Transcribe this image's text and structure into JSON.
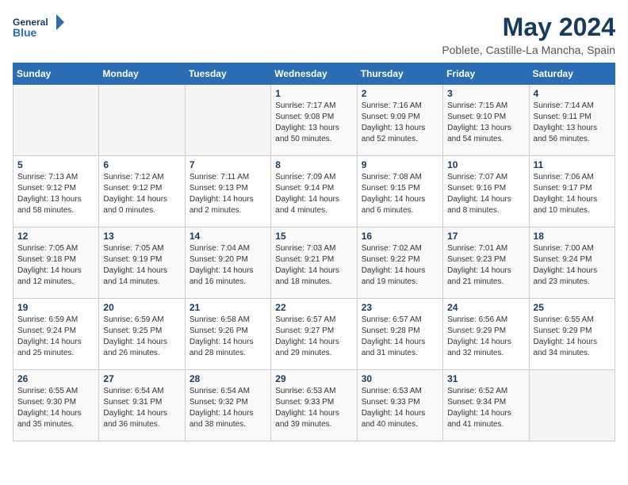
{
  "logo": {
    "line1": "General",
    "line2": "Blue"
  },
  "title": "May 2024",
  "location": "Poblete, Castille-La Mancha, Spain",
  "weekdays": [
    "Sunday",
    "Monday",
    "Tuesday",
    "Wednesday",
    "Thursday",
    "Friday",
    "Saturday"
  ],
  "weeks": [
    [
      {
        "day": "",
        "info": ""
      },
      {
        "day": "",
        "info": ""
      },
      {
        "day": "",
        "info": ""
      },
      {
        "day": "1",
        "info": "Sunrise: 7:17 AM\nSunset: 9:08 PM\nDaylight: 13 hours\nand 50 minutes."
      },
      {
        "day": "2",
        "info": "Sunrise: 7:16 AM\nSunset: 9:09 PM\nDaylight: 13 hours\nand 52 minutes."
      },
      {
        "day": "3",
        "info": "Sunrise: 7:15 AM\nSunset: 9:10 PM\nDaylight: 13 hours\nand 54 minutes."
      },
      {
        "day": "4",
        "info": "Sunrise: 7:14 AM\nSunset: 9:11 PM\nDaylight: 13 hours\nand 56 minutes."
      }
    ],
    [
      {
        "day": "5",
        "info": "Sunrise: 7:13 AM\nSunset: 9:12 PM\nDaylight: 13 hours\nand 58 minutes."
      },
      {
        "day": "6",
        "info": "Sunrise: 7:12 AM\nSunset: 9:12 PM\nDaylight: 14 hours\nand 0 minutes."
      },
      {
        "day": "7",
        "info": "Sunrise: 7:11 AM\nSunset: 9:13 PM\nDaylight: 14 hours\nand 2 minutes."
      },
      {
        "day": "8",
        "info": "Sunrise: 7:09 AM\nSunset: 9:14 PM\nDaylight: 14 hours\nand 4 minutes."
      },
      {
        "day": "9",
        "info": "Sunrise: 7:08 AM\nSunset: 9:15 PM\nDaylight: 14 hours\nand 6 minutes."
      },
      {
        "day": "10",
        "info": "Sunrise: 7:07 AM\nSunset: 9:16 PM\nDaylight: 14 hours\nand 8 minutes."
      },
      {
        "day": "11",
        "info": "Sunrise: 7:06 AM\nSunset: 9:17 PM\nDaylight: 14 hours\nand 10 minutes."
      }
    ],
    [
      {
        "day": "12",
        "info": "Sunrise: 7:05 AM\nSunset: 9:18 PM\nDaylight: 14 hours\nand 12 minutes."
      },
      {
        "day": "13",
        "info": "Sunrise: 7:05 AM\nSunset: 9:19 PM\nDaylight: 14 hours\nand 14 minutes."
      },
      {
        "day": "14",
        "info": "Sunrise: 7:04 AM\nSunset: 9:20 PM\nDaylight: 14 hours\nand 16 minutes."
      },
      {
        "day": "15",
        "info": "Sunrise: 7:03 AM\nSunset: 9:21 PM\nDaylight: 14 hours\nand 18 minutes."
      },
      {
        "day": "16",
        "info": "Sunrise: 7:02 AM\nSunset: 9:22 PM\nDaylight: 14 hours\nand 19 minutes."
      },
      {
        "day": "17",
        "info": "Sunrise: 7:01 AM\nSunset: 9:23 PM\nDaylight: 14 hours\nand 21 minutes."
      },
      {
        "day": "18",
        "info": "Sunrise: 7:00 AM\nSunset: 9:24 PM\nDaylight: 14 hours\nand 23 minutes."
      }
    ],
    [
      {
        "day": "19",
        "info": "Sunrise: 6:59 AM\nSunset: 9:24 PM\nDaylight: 14 hours\nand 25 minutes."
      },
      {
        "day": "20",
        "info": "Sunrise: 6:59 AM\nSunset: 9:25 PM\nDaylight: 14 hours\nand 26 minutes."
      },
      {
        "day": "21",
        "info": "Sunrise: 6:58 AM\nSunset: 9:26 PM\nDaylight: 14 hours\nand 28 minutes."
      },
      {
        "day": "22",
        "info": "Sunrise: 6:57 AM\nSunset: 9:27 PM\nDaylight: 14 hours\nand 29 minutes."
      },
      {
        "day": "23",
        "info": "Sunrise: 6:57 AM\nSunset: 9:28 PM\nDaylight: 14 hours\nand 31 minutes."
      },
      {
        "day": "24",
        "info": "Sunrise: 6:56 AM\nSunset: 9:29 PM\nDaylight: 14 hours\nand 32 minutes."
      },
      {
        "day": "25",
        "info": "Sunrise: 6:55 AM\nSunset: 9:29 PM\nDaylight: 14 hours\nand 34 minutes."
      }
    ],
    [
      {
        "day": "26",
        "info": "Sunrise: 6:55 AM\nSunset: 9:30 PM\nDaylight: 14 hours\nand 35 minutes."
      },
      {
        "day": "27",
        "info": "Sunrise: 6:54 AM\nSunset: 9:31 PM\nDaylight: 14 hours\nand 36 minutes."
      },
      {
        "day": "28",
        "info": "Sunrise: 6:54 AM\nSunset: 9:32 PM\nDaylight: 14 hours\nand 38 minutes."
      },
      {
        "day": "29",
        "info": "Sunrise: 6:53 AM\nSunset: 9:33 PM\nDaylight: 14 hours\nand 39 minutes."
      },
      {
        "day": "30",
        "info": "Sunrise: 6:53 AM\nSunset: 9:33 PM\nDaylight: 14 hours\nand 40 minutes."
      },
      {
        "day": "31",
        "info": "Sunrise: 6:52 AM\nSunset: 9:34 PM\nDaylight: 14 hours\nand 41 minutes."
      },
      {
        "day": "",
        "info": ""
      }
    ]
  ]
}
